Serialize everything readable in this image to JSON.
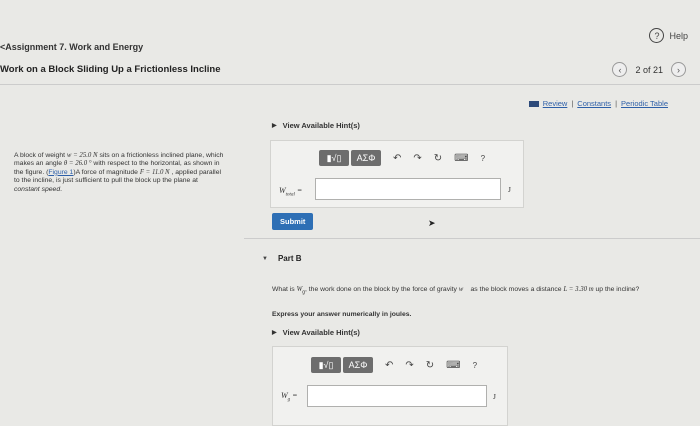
{
  "header": {
    "back_label": "Assignment 7. Work and Energy",
    "back_arrow": "<",
    "title": "Work on a Block Sliding Up a Frictionless Incline",
    "help_label": "Help",
    "help_icon": "?",
    "pager_text": "2 of 21",
    "prev_icon": "‹",
    "next_icon": "›"
  },
  "resources": {
    "review": "Review",
    "constants": "Constants",
    "periodic_table": "Periodic Table",
    "sep": "|"
  },
  "problem": {
    "text_1": "A block of weight ",
    "w_expr": "w = 25.0 N",
    "text_2": " sits on a frictionless inclined plane, which makes an angle ",
    "theta_expr": "θ = 26.0 °",
    "text_3": " with respect to the horizontal, as shown in the figure. (",
    "figure_link": "Figure 1",
    "text_4": ")A force of magnitude ",
    "f_expr": "F = 11.0 N",
    "text_5": " , applied parallel to the incline, is just sufficient to pull the block up the plane at ",
    "text_6": "constant speed",
    "text_7": "."
  },
  "part_a": {
    "hints_label": "View Available Hint(s)",
    "var_label": "W",
    "var_sub": "total",
    "equals": " =",
    "unit": "J",
    "submit_label": "Submit",
    "answer_value": ""
  },
  "toolbar": {
    "templates_label": "▮√▯",
    "symbols_label": "ΑΣΦ",
    "undo": "↶",
    "redo": "↷",
    "reset": "↻",
    "keyboard": "⌨",
    "help": "?"
  },
  "part_b": {
    "label": "Part B",
    "collapse_icon": "▼",
    "question_1": "What is ",
    "var": "W",
    "var_sub": "g",
    "question_2": ", the work done on the block by the force of gravity ",
    "w_vec": "w⃗",
    "question_3": " as the block moves a distance ",
    "l_expr": "L = 3.30 m",
    "question_4": " up the incline?",
    "express": "Express your answer numerically in joules.",
    "hints_label": "View Available Hint(s)",
    "equals": " =",
    "unit": "J",
    "answer_value": ""
  },
  "colors": {
    "accent": "#2e6fb5",
    "link": "#2d5fa8",
    "background": "#e9e9e6"
  }
}
